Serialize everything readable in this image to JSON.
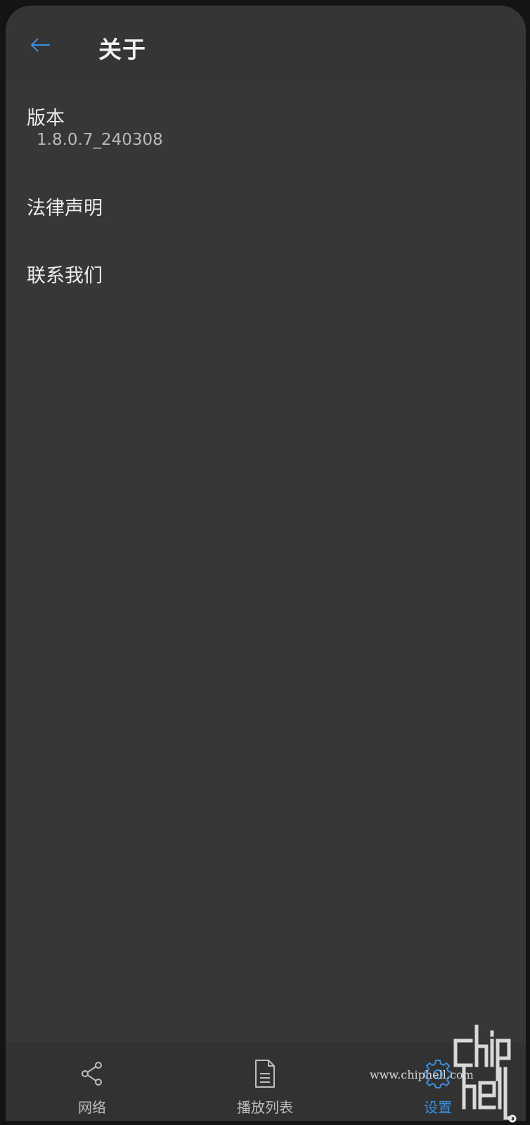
{
  "header": {
    "title": "关于",
    "back_icon": "arrow-left-icon"
  },
  "menu": {
    "items": [
      {
        "label": "版本",
        "value": "1.8.0.7_240308"
      },
      {
        "label": "法律声明"
      },
      {
        "label": "联系我们"
      }
    ]
  },
  "bottom_nav": {
    "items": [
      {
        "label": "网络",
        "icon": "share-network-icon"
      },
      {
        "label": "播放列表",
        "icon": "document-icon"
      },
      {
        "label": "设置",
        "icon": "gear-icon",
        "active": true
      }
    ]
  },
  "watermark": {
    "text": "www.chiphell.com",
    "logo": "chiphell"
  },
  "colors": {
    "accent": "#3a8ee0",
    "background": "#373737",
    "text": "#ededed"
  }
}
